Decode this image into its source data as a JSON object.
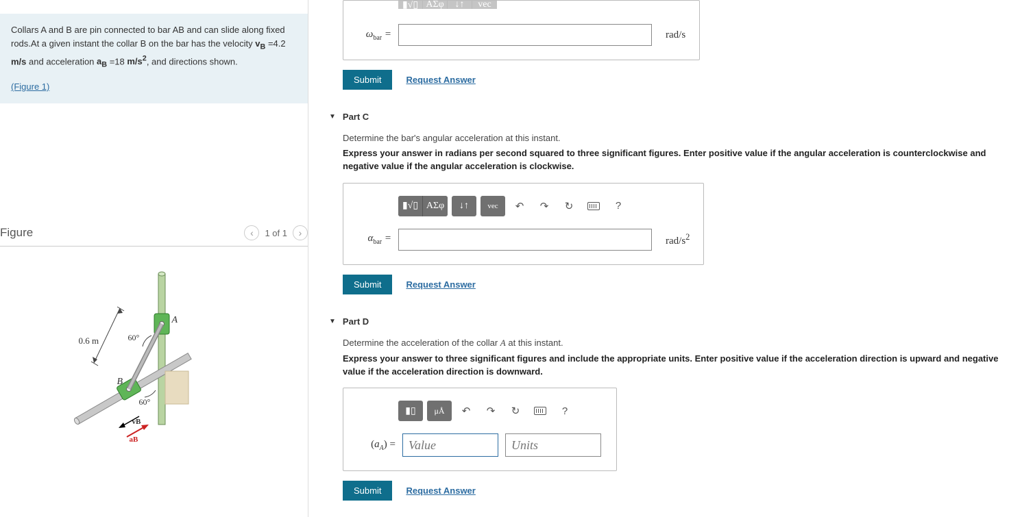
{
  "problem": {
    "text1": "Collars A and B are pin connected to bar AB and can slide along fixed rods.At a given instant the collar B on the bar has the velocity ",
    "vB_sym": "v",
    "vB_sub": "B",
    "vB_eq": " =4.2 ",
    "vB_unit": "m/s",
    "text2": " and acceleration ",
    "aB_sym": "a",
    "aB_sub": "B",
    "aB_eq": " =18 ",
    "aB_unit": "m/s",
    "aB_exp": "2",
    "text3": ", and directions shown.",
    "figure_link": "(Figure 1)"
  },
  "figure": {
    "title": "Figure",
    "counter": "1 of 1",
    "labels": {
      "dim": "0.6 m",
      "ang1": "60°",
      "ang2": "60°",
      "A": "A",
      "B": "B",
      "vB": "vB",
      "aB": "aB"
    }
  },
  "partB": {
    "var": "ω",
    "sub": "bar",
    "eq": " = ",
    "unit": "rad/s",
    "submit": "Submit",
    "request": "Request Answer"
  },
  "partC": {
    "title": "Part C",
    "prompt": "Determine the bar's angular acceleration at this instant.",
    "hint": "Express your answer in radians per second squared to three significant figures. Enter positive value if the angular acceleration is counterclockwise and negative value if the angular acceleration is clockwise.",
    "var": "α",
    "sub": "bar",
    "eq": " = ",
    "unit": "rad/s",
    "unit_exp": "2",
    "submit": "Submit",
    "request": "Request Answer"
  },
  "partD": {
    "title": "Part D",
    "prompt_a": "Determine the acceleration of the collar ",
    "prompt_var": "A",
    "prompt_b": " at this instant.",
    "hint": "Express your answer to three significant figures and include the appropriate units. Enter positive value if the acceleration direction is upward and negative value if the acceleration direction is downward.",
    "var_open": "(",
    "var": "a",
    "var_sub": "A",
    "var_close": ") = ",
    "value_ph": "Value",
    "units_ph": "Units",
    "submit": "Submit",
    "request": "Request Answer"
  },
  "toolbar": {
    "templates": "▮√▯",
    "asigma": "ΑΣφ",
    "arrows": "↓↑",
    "vec": "vec",
    "undo": "↶",
    "redo": "↷",
    "reset": "↻",
    "help": "?",
    "frac": "▮▯",
    "mu": "μÅ"
  }
}
